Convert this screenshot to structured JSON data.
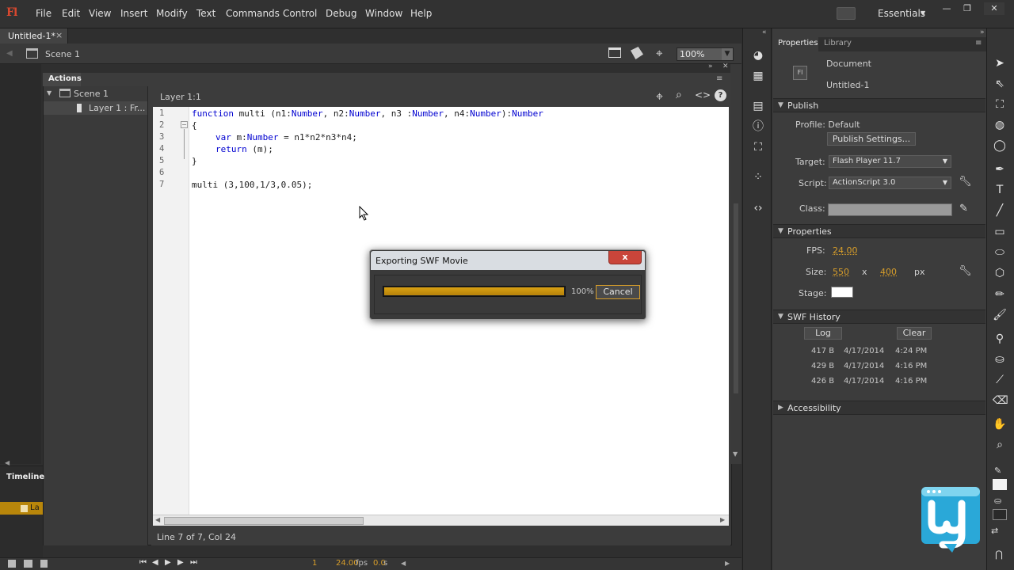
{
  "app": {
    "logo": "Fl",
    "workspace": "Essentials"
  },
  "menu": [
    "File",
    "Edit",
    "View",
    "Insert",
    "Modify",
    "Text",
    "Commands",
    "Control",
    "Debug",
    "Window",
    "Help"
  ],
  "document_tab": {
    "title": "Untitled-1*",
    "close": "×"
  },
  "edit_bar": {
    "scene": "Scene 1",
    "zoom": "100%"
  },
  "actions_panel": {
    "tab": "Actions",
    "tree": {
      "scene": "Scene 1",
      "layer": "Layer 1 : Fr..."
    },
    "script_title": "Layer 1:1",
    "line_numbers": [
      "1",
      "2",
      "3",
      "4",
      "5",
      "6",
      "7"
    ],
    "status": "Line 7 of 7, Col 24"
  },
  "code_text": {
    "l1_kw": "function",
    "l1_a": " multi (n1:",
    "l1_t1": "Number",
    "l1_b": ", n2:",
    "l1_t2": "Number",
    "l1_c": ", n3 :",
    "l1_t3": "Number",
    "l1_d": ", n4:",
    "l1_t4": "Number",
    "l1_e": "):",
    "l1_t5": "Number",
    "l2": "{",
    "l3_kw": "var",
    "l3_a": " m:",
    "l3_t": "Number",
    "l3_b": " = n1*n2*n3*n4;",
    "l4_kw": "return",
    "l4_a": " (m);",
    "l5": "}",
    "l7": "multi (3,100,1/3,0.05);"
  },
  "timeline": {
    "label": "Timeline",
    "layer": "La",
    "frame": "1",
    "fps": "24.00",
    "fps_unit": "fps",
    "time": "0.0",
    "time_unit": "s"
  },
  "properties": {
    "tabs": [
      "Properties",
      "Library"
    ],
    "doc_icon": "Fl",
    "doc_type": "Document",
    "doc_name": "Untitled-1",
    "publish": {
      "header": "Publish",
      "profile": "Profile: Default",
      "settings_button": "Publish Settings...",
      "target_label": "Target:",
      "target": "Flash Player 11.7",
      "script_label": "Script:",
      "script": "ActionScript 3.0",
      "class_label": "Class:"
    },
    "props": {
      "header": "Properties",
      "fps_label": "FPS:",
      "fps": "24.00",
      "size_label": "Size:",
      "width": "550",
      "x": "x",
      "height": "400",
      "unit": "px",
      "stage_label": "Stage:",
      "stage_color": "#ffffff"
    },
    "swf_history": {
      "header": "SWF History",
      "log": "Log",
      "clear": "Clear",
      "rows": [
        {
          "size": "417 B",
          "date": "4/17/2014",
          "time": "4:24 PM"
        },
        {
          "size": "429 B",
          "date": "4/17/2014",
          "time": "4:16 PM"
        },
        {
          "size": "426 B",
          "date": "4/17/2014",
          "time": "4:16 PM"
        }
      ]
    },
    "accessibility": "Accessibility"
  },
  "dialog": {
    "title": "Exporting SWF Movie",
    "close": "x",
    "progress": 1.0,
    "progress_text": "100%",
    "cancel": "Cancel"
  },
  "colors": {
    "accent": "#d89e2a",
    "panel": "#3c3c3c",
    "logo_red": "#d8482f",
    "watermark": "#2aa8d8"
  }
}
